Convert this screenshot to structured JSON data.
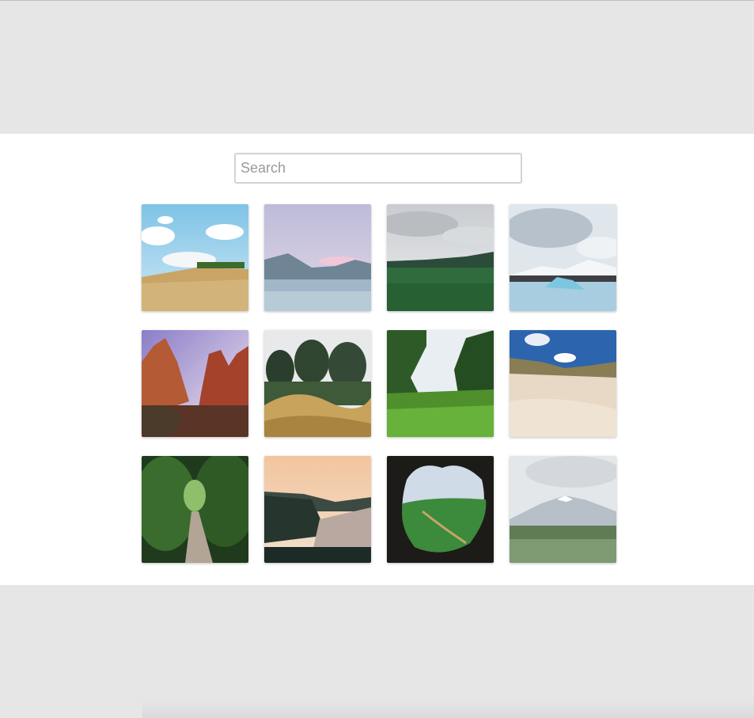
{
  "search": {
    "placeholder": "Search",
    "value": ""
  },
  "gallery": {
    "photos": [
      {
        "subject": "hay-field-under-clouds"
      },
      {
        "subject": "misty-lake-mountains"
      },
      {
        "subject": "green-meadow-cloudy"
      },
      {
        "subject": "glacier-lagoon-icebergs"
      },
      {
        "subject": "red-rock-canyon"
      },
      {
        "subject": "pine-trees-golden-brush"
      },
      {
        "subject": "green-valley-grass"
      },
      {
        "subject": "sand-dunes-blue-sky"
      },
      {
        "subject": "forest-path-tunnel"
      },
      {
        "subject": "coastal-sunset-cliffs"
      },
      {
        "subject": "cave-window-valley"
      },
      {
        "subject": "snowy-mountain-lupine-field"
      }
    ]
  }
}
